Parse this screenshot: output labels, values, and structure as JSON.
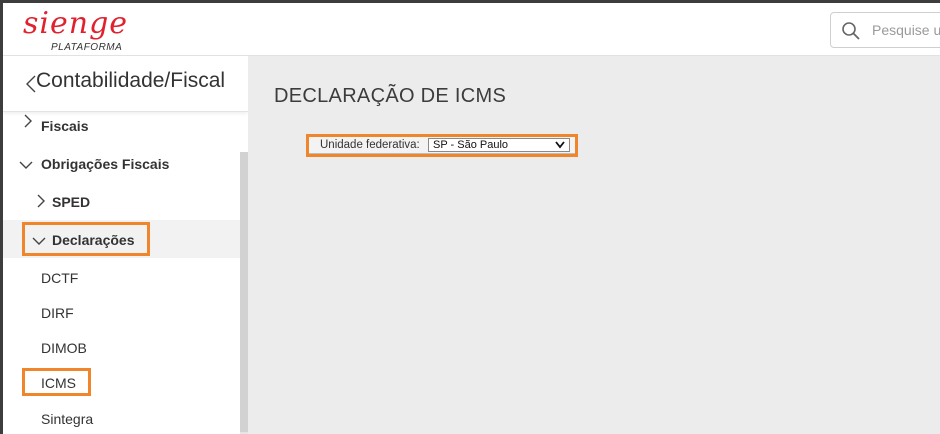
{
  "header": {
    "logo_text": "sienge",
    "logo_subtitle": "PLATAFORMA",
    "search_placeholder": "Pesquise u"
  },
  "sidebar": {
    "title": "Contabilidade/Fiscal",
    "items": [
      {
        "label": "Fiscais",
        "type": "group",
        "expanded": false
      },
      {
        "label": "Obrigações Fiscais",
        "type": "group",
        "expanded": true
      },
      {
        "label": "SPED",
        "type": "group",
        "expanded": false
      },
      {
        "label": "Declarações",
        "type": "group",
        "expanded": true,
        "selected": true
      },
      {
        "label": "DCTF",
        "type": "leaf"
      },
      {
        "label": "DIRF",
        "type": "leaf"
      },
      {
        "label": "DIMOB",
        "type": "leaf"
      },
      {
        "label": "ICMS",
        "type": "leaf"
      },
      {
        "label": "Sintegra",
        "type": "leaf"
      }
    ]
  },
  "main": {
    "page_title": "DECLARAÇÃO DE ICMS",
    "uf_label": "Unidade federativa:",
    "uf_value": "SP - São Paulo"
  },
  "colors": {
    "brand": "#e0222e",
    "highlight": "#f0862b"
  }
}
